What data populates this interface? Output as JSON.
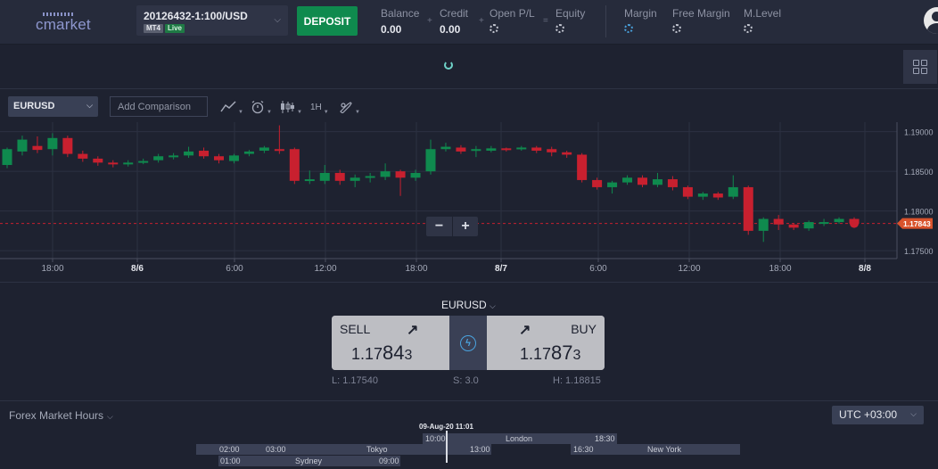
{
  "header": {
    "logo_text": "cmarket",
    "account": {
      "id": "20126432-1:100/USD",
      "platform": "MT4",
      "mode": "Live"
    },
    "deposit_label": "DEPOSIT",
    "stats": [
      {
        "label": "Balance",
        "value": "0.00"
      },
      {
        "label": "Credit",
        "value": "0.00"
      },
      {
        "label": "Open P/L",
        "value": ""
      },
      {
        "label": "Equity",
        "value": ""
      },
      {
        "label": "Margin",
        "value": ""
      },
      {
        "label": "Free Margin",
        "value": ""
      },
      {
        "label": "M.Level",
        "value": ""
      }
    ],
    "operators": [
      "+",
      "+",
      "="
    ]
  },
  "chart_toolbar": {
    "symbol": "EURUSD",
    "compare_placeholder": "Add Comparison",
    "timeframe": "1H",
    "icons": [
      "line-chart-icon",
      "alarm-icon",
      "candles-icon",
      "timeframe",
      "tools-icon"
    ]
  },
  "chart_data": {
    "type": "candlestick",
    "symbol": "EURUSD",
    "ylim": [
      1.174,
      1.1912
    ],
    "yticks": [
      "1.19000",
      "1.18500",
      "1.18000",
      "1.17500"
    ],
    "ytick_values": [
      1.19,
      1.185,
      1.18,
      1.175
    ],
    "xticks": [
      "18:00",
      "8/6",
      "6:00",
      "12:00",
      "18:00",
      "8/7",
      "6:00",
      "12:00",
      "18:00",
      "8/8"
    ],
    "current_price": "1.17843",
    "current_value": 1.17843,
    "candles": [
      [
        1.1858,
        1.1878,
        1.1854,
        1.188
      ],
      [
        1.1875,
        1.189,
        1.187,
        1.1895
      ],
      [
        1.1882,
        1.1877,
        1.1873,
        1.1894
      ],
      [
        1.1878,
        1.1892,
        1.187,
        1.1898
      ],
      [
        1.1892,
        1.1872,
        1.1868,
        1.1895
      ],
      [
        1.1872,
        1.1866,
        1.1862,
        1.1876
      ],
      [
        1.1866,
        1.1861,
        1.1857,
        1.1869
      ],
      [
        1.1861,
        1.1859,
        1.1855,
        1.1864
      ],
      [
        1.1859,
        1.1861,
        1.1856,
        1.1864
      ],
      [
        1.1862,
        1.1863,
        1.1859,
        1.1866
      ],
      [
        1.1864,
        1.1869,
        1.1861,
        1.1872
      ],
      [
        1.1868,
        1.187,
        1.1865,
        1.1873
      ],
      [
        1.187,
        1.1875,
        1.1867,
        1.1881
      ],
      [
        1.1876,
        1.1869,
        1.1866,
        1.188
      ],
      [
        1.1869,
        1.1864,
        1.186,
        1.1872
      ],
      [
        1.1863,
        1.187,
        1.186,
        1.1872
      ],
      [
        1.1872,
        1.1875,
        1.1869,
        1.1877
      ],
      [
        1.1876,
        1.188,
        1.1873,
        1.1882
      ],
      [
        1.1878,
        1.1876,
        1.1872,
        1.1908
      ],
      [
        1.1878,
        1.1838,
        1.1834,
        1.188
      ],
      [
        1.1838,
        1.184,
        1.1834,
        1.1851
      ],
      [
        1.1838,
        1.1848,
        1.1834,
        1.1858
      ],
      [
        1.1848,
        1.1838,
        1.1833,
        1.1852
      ],
      [
        1.1838,
        1.1842,
        1.183,
        1.1846
      ],
      [
        1.1842,
        1.1844,
        1.1836,
        1.1848
      ],
      [
        1.1843,
        1.185,
        1.1839,
        1.186
      ],
      [
        1.185,
        1.1842,
        1.1819,
        1.1852
      ],
      [
        1.1842,
        1.1848,
        1.1838,
        1.1852
      ],
      [
        1.185,
        1.1878,
        1.1846,
        1.189
      ],
      [
        1.1878,
        1.1881,
        1.1875,
        1.1886
      ],
      [
        1.188,
        1.1875,
        1.1872,
        1.1883
      ],
      [
        1.1876,
        1.1878,
        1.1868,
        1.1882
      ],
      [
        1.1876,
        1.1879,
        1.1874,
        1.1882
      ],
      [
        1.1879,
        1.1877,
        1.1875,
        1.188
      ],
      [
        1.1878,
        1.188,
        1.1876,
        1.1882
      ],
      [
        1.188,
        1.1876,
        1.1873,
        1.1882
      ],
      [
        1.1878,
        1.1874,
        1.1869,
        1.1881
      ],
      [
        1.1874,
        1.1871,
        1.1867,
        1.1876
      ],
      [
        1.1871,
        1.1839,
        1.1836,
        1.1873
      ],
      [
        1.1839,
        1.183,
        1.1827,
        1.1842
      ],
      [
        1.183,
        1.1836,
        1.1822,
        1.1838
      ],
      [
        1.1836,
        1.1842,
        1.1833,
        1.1845
      ],
      [
        1.1842,
        1.1833,
        1.183,
        1.1845
      ],
      [
        1.1833,
        1.184,
        1.183,
        1.1848
      ],
      [
        1.184,
        1.183,
        1.1826,
        1.1844
      ],
      [
        1.183,
        1.1818,
        1.1815,
        1.1832
      ],
      [
        1.1818,
        1.1822,
        1.1814,
        1.1824
      ],
      [
        1.1822,
        1.1817,
        1.1814,
        1.1824
      ],
      [
        1.1818,
        1.183,
        1.1815,
        1.1845
      ],
      [
        1.183,
        1.1775,
        1.177,
        1.1832
      ],
      [
        1.1775,
        1.179,
        1.1761,
        1.1792
      ],
      [
        1.179,
        1.1783,
        1.1776,
        1.1795
      ],
      [
        1.1783,
        1.1779,
        1.1776,
        1.1785
      ],
      [
        1.1778,
        1.1786,
        1.1775,
        1.1788
      ],
      [
        1.1784,
        1.1786,
        1.1781,
        1.179
      ],
      [
        1.1786,
        1.179,
        1.1784,
        1.1792
      ],
      [
        1.179,
        1.1784,
        1.1782,
        1.1792
      ]
    ]
  },
  "trade": {
    "symbol": "EURUSD",
    "sell_label": "SELL",
    "buy_label": "BUY",
    "sell_price": {
      "a": "1.17",
      "b": "84",
      "c": "3"
    },
    "buy_price": {
      "a": "1.17",
      "b": "87",
      "c": "3"
    },
    "low": "L: 1.17540",
    "spread": "S: 3.0",
    "high": "H: 1.18815"
  },
  "market_hours": {
    "title": "Forex Market Hours",
    "timezone": "UTC +03:00",
    "now_label": "09-Aug-20 11:01",
    "sessions": [
      {
        "name": "Tokyo",
        "open": "02:00",
        "mid": "03:00",
        "close": "13:00"
      },
      {
        "name": "London",
        "open": "10:00",
        "close": "18:30"
      },
      {
        "name": "New York",
        "open": "16:30",
        "close": ""
      },
      {
        "name": "Sydney",
        "open": "01:00",
        "close": "09:00"
      }
    ]
  },
  "colors": {
    "bull": "#0f8a4e",
    "bear": "#c8202f",
    "price_tag": "#d9532c",
    "accent": "#4aa3df"
  }
}
